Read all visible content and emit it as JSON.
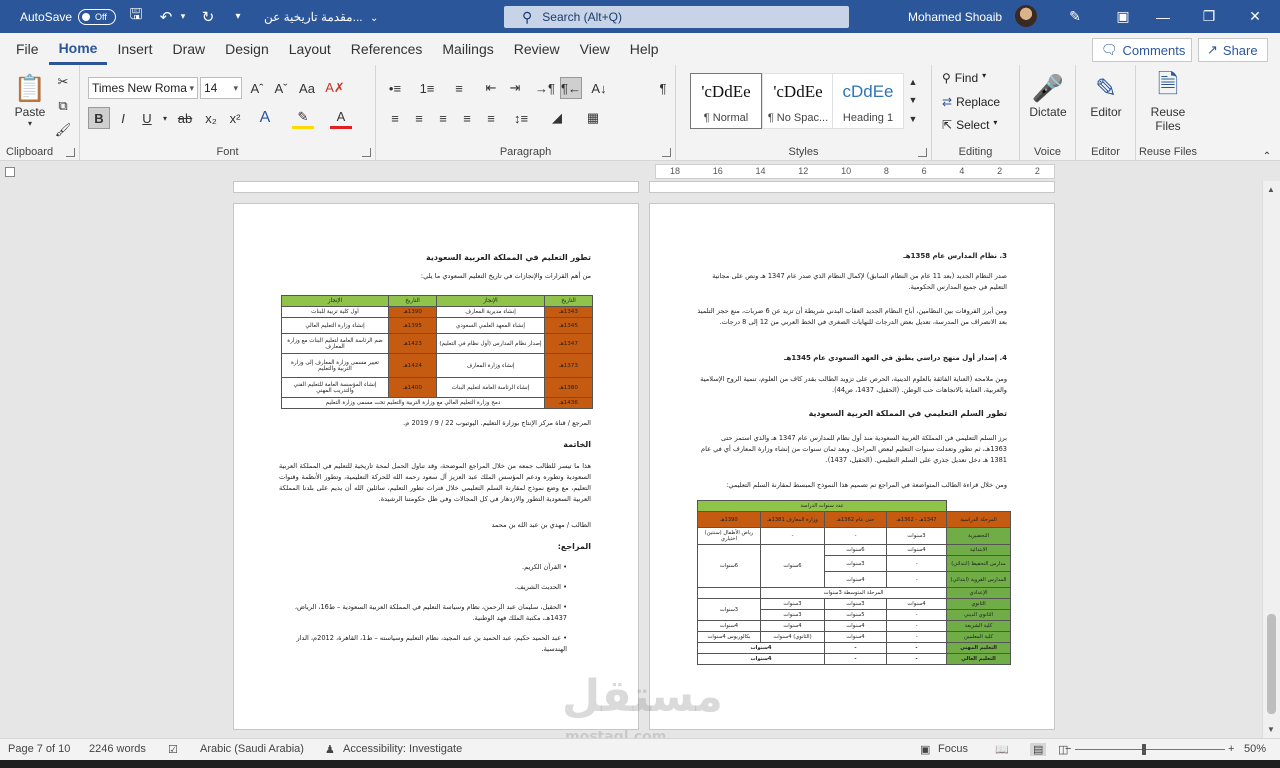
{
  "titlebar": {
    "autosave_label": "AutoSave",
    "autosave_state": "Off",
    "document_title": "مقدمة تاريخية عن...",
    "search_placeholder": "Search (Alt+Q)",
    "user_name": "Mohamed Shoaib"
  },
  "menu": {
    "tabs": [
      "File",
      "Home",
      "Insert",
      "Draw",
      "Design",
      "Layout",
      "References",
      "Mailings",
      "Review",
      "View",
      "Help"
    ],
    "active": "Home",
    "comments_label": "Comments",
    "share_label": "Share"
  },
  "ribbon": {
    "clipboard": {
      "label": "Clipboard",
      "paste": "Paste"
    },
    "font": {
      "label": "Font",
      "font_name": "Times New Roma",
      "font_size": "14"
    },
    "paragraph": {
      "label": "Paragraph"
    },
    "styles": {
      "label": "Styles",
      "items": [
        {
          "sample": "'cDdEe",
          "name": "¶ Normal"
        },
        {
          "sample": "'cDdEe",
          "name": "¶ No Spac..."
        },
        {
          "sample": "cDdEe",
          "name": "Heading 1"
        }
      ]
    },
    "editing": {
      "label": "Editing",
      "find": "Find",
      "replace": "Replace",
      "select": "Select"
    },
    "voice": {
      "label": "Voice",
      "dictate": "Dictate"
    },
    "editor": {
      "label": "Editor",
      "editor": "Editor"
    },
    "reuse": {
      "label": "Reuse Files",
      "reuse_line1": "Reuse",
      "reuse_line2": "Files"
    }
  },
  "ruler": {
    "ticks": [
      "18",
      "16",
      "14",
      "12",
      "10",
      "8",
      "6",
      "4",
      "2",
      "2"
    ]
  },
  "left_page": {
    "title": "تطور التعليم في المملكة العربية السعودية",
    "intro": "من أهم القرارات والإنجازات في تاريخ التعليم السعودي ما يلي:",
    "table_headers": [
      "التاريخ",
      "الإنجاز",
      "التاريخ",
      "الإنجاز"
    ],
    "table_rows": [
      [
        "1343هـ",
        "إنشاء مديرية المعارف",
        "1390هـ",
        "أول كلية تربية للبنات"
      ],
      [
        "1345هـ",
        "إنشاء المعهد العلمي السعودي",
        "1395هـ",
        "إنشاء وزارة التعليم العالي"
      ],
      [
        "1347هـ",
        "إصدار نظام المدارس (أول نظام في التعليم)",
        "1423هـ",
        "ضم الرئاسة العامة لتعليم البنات مع وزارة المعارف"
      ],
      [
        "1373هـ",
        "إنشاء وزارة المعارف",
        "1424هـ",
        "تغيير مسمى وزارة المعارف إلى وزارة التربية والتعليم"
      ],
      [
        "1380هـ",
        "إنشاء الرئاسة العامة لتعليم البنات",
        "1400هـ",
        "إنشاء المؤسسة العامة للتعليم الفني والتدريب المهني"
      ]
    ],
    "table_last": [
      "1436هـ",
      "دمج وزارة التعليم العالي مع وزارة التربية والتعليم تحت مسمى وزارة التعليم"
    ],
    "source": "المرجع / قناة مركز الإنتاج بوزارة التعليم. اليوتيوب 22 / 9 / 2019 م.",
    "conclusion_heading": "الخاتمة",
    "conclusion": "هذا ما تيسر للطالب جمعه من خلال المراجع الموضحة، وقد تناول الحمل لمحة تاريخية للتعليم في المملكة العربية السعودية وتطوره ودعم المؤسس الملك عبد العزيز آل سعود رحمه الله للحركة التعليمية، وتطور الأنظمة وقنوات التعليم، مع وضع نموذج لمقارنة السلم التعليمي خلال فترات تطور التعليم، سائلين الله أن يديم على بلدنا المملكة العربية السعودية التطور والازدهار في كل المجالات وفي ظل حكومتنا الرشيدة.",
    "signature": "الطالب / مهدي بن عبد الله بن محمد",
    "references_heading": "المراجع:",
    "references": [
      "القرآن الكريم.",
      "الحديث الشريف.",
      "الحقيل، سليمان عبد الرحمن، نظام وسياسة التعليم في المملكة العربية السعودية – ط16، الرياض، 1437هـ، مكتبة الملك فهد الوطنية.",
      "عبد الحميد حكيم، عبد الحميد بن عبد المجيد، نظام التعليم وسياسته – ط1، القاهرة، 2012م، الدار الهندسية."
    ]
  },
  "right_page": {
    "h3": "3. نظام المدارس عام 1358هـ",
    "p1": "صدر النظام الجديد (بعد 11 عام من النظام السابق) لإكمال النظام الذي صدر عام 1347 هـ ونص على مجانية التعليم في جميع المدارس الحكومية.",
    "p2": "ومن أبرز الفروقات بين النظامين، أباح النظام الجديد العقاب البدني شريطة أن تزيد عن 6 ضربات، منع حجز التلميذ بعد الانصراف من المدرسة، تعديل بعض الدرجات للنهايات الصغرى في الخط العربي من 12 إلى 8 درجات.",
    "h4": "4. إصدار أول منهج دراسي يطبق في العهد السعودي عام 1345هـ",
    "p3": "ومن ملامحه (العناية الفائقة بالعلوم الدينية، الحرص على تزويد الطالب بقدر كاف من العلوم، تنمية الروح الإسلامية والعربية، العناية بالاتجاهات حب الوطن. (الحقيل، 1437، ص44).",
    "ladder_heading": "تطور السلم التعليمي في المملكة العربية السعودية",
    "p4": "برز السلم التعليمي في المملكة العربية السعودية منذ أول نظام للمدارس عام 1347 هـ والذي استمر حتى 1363هـ، ثم تطور وتعدلت سنوات التعليم لبعض المراحل، وبعد ثمان سنوات من إنشاء وزارة المعارف أي في عام 1381 هـ دخل تعديل جذري على السلم التعليمي. (الحقيل، 1437).",
    "p5": "ومن خلال قراءة الطالب المتواضعة في المراجع تم تصميم هذا النموذج المبسط لمقارنة السلم التعليمي:",
    "ladder_top": "عدد سنوات الدراسة",
    "ladder_headers": [
      "المرحلة الدراسية",
      "1347هـ - 1362هـ",
      "حتى عام 1362هـ",
      "وزارة المعارف 1381هـ",
      "1390هـ"
    ],
    "ladder_rows": [
      [
        "التحضيرية",
        "3سنوات",
        "-",
        "-",
        "رياض الأطفال (سنتين) اختياري"
      ],
      [
        "الابتدائية",
        "4سنوات",
        "6سنوات",
        "6سنوات",
        "6سنوات"
      ],
      [
        "مدارس التحفيظ (ابتدائي)",
        "-",
        "3سنوات",
        "",
        ""
      ],
      [
        "المدارس القروية (ابتدائي)",
        "-",
        "4سنوات",
        "",
        ""
      ],
      [
        "الإعدادي",
        "",
        "",
        "المرحلة المتوسطة 3سنوات",
        ""
      ],
      [
        "الثانوي",
        "4سنوات",
        "3سنوات",
        "3سنوات",
        "3سنوات"
      ],
      [
        "الثانوي الديني",
        "-",
        "5سنوات",
        "3سنوات",
        ""
      ],
      [
        "كلية الشريعة",
        "-",
        "4سنوات",
        "4سنوات",
        "4سنوات"
      ],
      [
        "كلية المعلمين",
        "-",
        "4سنوات",
        "(الثانوي) 4سنوات",
        "بكالوريوس 4سنوات"
      ],
      [
        "التعليم المهني",
        "-",
        "-",
        "4سنوات",
        ""
      ],
      [
        "التعليم العالي",
        "-",
        "-",
        "4سنوات",
        ""
      ]
    ]
  },
  "statusbar": {
    "page": "Page 7 of 10",
    "words": "2246 words",
    "language": "Arabic (Saudi Arabia)",
    "accessibility": "Accessibility: Investigate",
    "focus": "Focus",
    "zoom": "50%"
  },
  "watermark": {
    "arabic": "مستقل",
    "latin": "mostaql.com"
  },
  "colors": {
    "word_blue": "#2b579a",
    "table_green": "#8fc34a",
    "table_orange": "#c55a11"
  }
}
